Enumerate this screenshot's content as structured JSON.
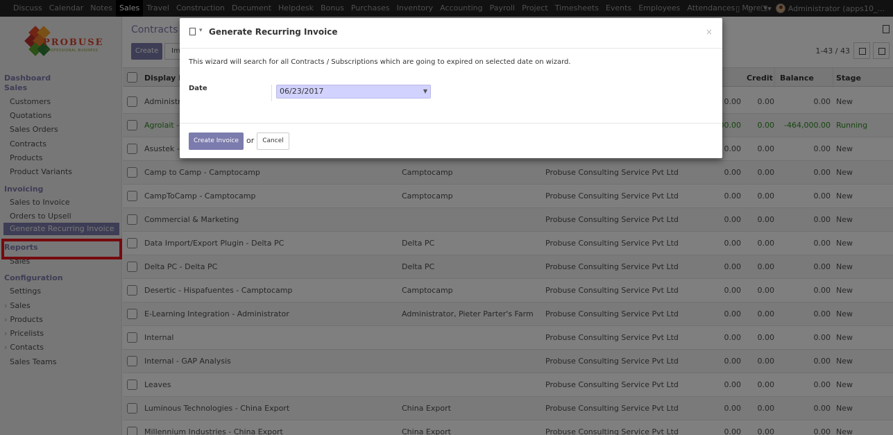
{
  "navbar": {
    "items": [
      "Discuss",
      "Calendar",
      "Notes",
      "Sales",
      "Travel",
      "Construction",
      "Document",
      "Helpdesk",
      "Bonus",
      "Purchases",
      "Inventory",
      "Accounting",
      "Payroll",
      "Project",
      "Timesheets",
      "Events",
      "Employees",
      "Attendances",
      "More ▾"
    ],
    "active": "Sales",
    "user": "Administrator (apps10_..."
  },
  "logo": {
    "text": "PROBUSE",
    "subtitle": "PROFESSIONAL BUSINESS"
  },
  "sidebar": {
    "sections": [
      {
        "title": "Dashboard"
      },
      {
        "title": "Sales",
        "items": [
          "Customers",
          "Quotations",
          "Sales Orders",
          "Contracts",
          "Products",
          "Product Variants"
        ]
      },
      {
        "title": "Invoicing",
        "items": [
          "Sales to Invoice",
          "Orders to Upsell",
          "Generate Recurring Invoice"
        ]
      },
      {
        "title": "Reports",
        "items": [
          "Sales"
        ]
      },
      {
        "title": "Configuration",
        "items": [
          "Settings",
          "Sales",
          "Products",
          "Pricelists",
          "Contacts",
          "Sales Teams"
        ]
      }
    ],
    "selected": "Generate Recurring Invoice"
  },
  "content": {
    "breadcrumb": "Contracts",
    "create_label": "Create",
    "import_label": "Im",
    "pager": "1-43 / 43",
    "columns": [
      "Display N",
      "Credit",
      "Balance",
      "Stage"
    ],
    "rows": [
      {
        "name": "Administra",
        "company": "",
        "partner": "",
        "debit": "0.00",
        "credit": "0.00",
        "balance": "0.00",
        "stage": "New"
      },
      {
        "name": "Agrolait - A",
        "company": "",
        "partner": "",
        "debit": "00.00",
        "credit": "0.00",
        "balance": "-464,000.00",
        "stage": "Running"
      },
      {
        "name": "Asustek - A",
        "company": "",
        "partner": "",
        "debit": "0.00",
        "credit": "0.00",
        "balance": "0.00",
        "stage": "New"
      },
      {
        "name": "Camp to Camp - Camptocamp",
        "company": "Camptocamp",
        "partner": "Probuse Consulting Service Pvt Ltd",
        "debit": "0.00",
        "credit": "0.00",
        "balance": "0.00",
        "stage": "New"
      },
      {
        "name": "CampToCamp - Camptocamp",
        "company": "Camptocamp",
        "partner": "Probuse Consulting Service Pvt Ltd",
        "debit": "0.00",
        "credit": "0.00",
        "balance": "0.00",
        "stage": "New"
      },
      {
        "name": "Commercial & Marketing",
        "company": "",
        "partner": "Probuse Consulting Service Pvt Ltd",
        "debit": "0.00",
        "credit": "0.00",
        "balance": "0.00",
        "stage": "New"
      },
      {
        "name": "Data Import/Export Plugin - Delta PC",
        "company": "Delta PC",
        "partner": "Probuse Consulting Service Pvt Ltd",
        "debit": "0.00",
        "credit": "0.00",
        "balance": "0.00",
        "stage": "New"
      },
      {
        "name": "Delta PC - Delta PC",
        "company": "Delta PC",
        "partner": "Probuse Consulting Service Pvt Ltd",
        "debit": "0.00",
        "credit": "0.00",
        "balance": "0.00",
        "stage": "New"
      },
      {
        "name": "Desertic - Hispafuentes - Camptocamp",
        "company": "Camptocamp",
        "partner": "Probuse Consulting Service Pvt Ltd",
        "debit": "0.00",
        "credit": "0.00",
        "balance": "0.00",
        "stage": "New"
      },
      {
        "name": "E-Learning Integration - Administrator",
        "company": "Administrator, Pieter Parter's Farm",
        "partner": "Probuse Consulting Service Pvt Ltd",
        "debit": "0.00",
        "credit": "0.00",
        "balance": "0.00",
        "stage": "New"
      },
      {
        "name": "Internal",
        "company": "",
        "partner": "Probuse Consulting Service Pvt Ltd",
        "debit": "0.00",
        "credit": "0.00",
        "balance": "0.00",
        "stage": "New"
      },
      {
        "name": "Internal - GAP Analysis",
        "company": "",
        "partner": "Probuse Consulting Service Pvt Ltd",
        "debit": "0.00",
        "credit": "0.00",
        "balance": "0.00",
        "stage": "New"
      },
      {
        "name": "Leaves",
        "company": "",
        "partner": "Probuse Consulting Service Pvt Ltd",
        "debit": "0.00",
        "credit": "0.00",
        "balance": "0.00",
        "stage": "New"
      },
      {
        "name": "Luminous Technologies - China Export",
        "company": "China Export",
        "partner": "Probuse Consulting Service Pvt Ltd",
        "debit": "0.00",
        "credit": "0.00",
        "balance": "0.00",
        "stage": "New"
      },
      {
        "name": "Millennium Industries - China Export",
        "company": "China Export",
        "partner": "Probuse Consulting Service Pvt Ltd",
        "debit": "0.00",
        "credit": "0.00",
        "balance": "0.00",
        "stage": "New"
      }
    ]
  },
  "modal": {
    "title": "Generate Recurring Invoice",
    "description": "This wizard will search for all Contracts / Subscriptions which are going to expired on selected date on wizard.",
    "date_label": "Date",
    "date_value": "06/23/2017",
    "create_label": "Create Invoice",
    "or_label": "or",
    "cancel_label": "Cancel",
    "close_label": "×"
  },
  "colors": {
    "accent": "#7c7bad",
    "navbar": "#222222",
    "highlight": "#e8141c",
    "running": "#2e8b1e"
  }
}
